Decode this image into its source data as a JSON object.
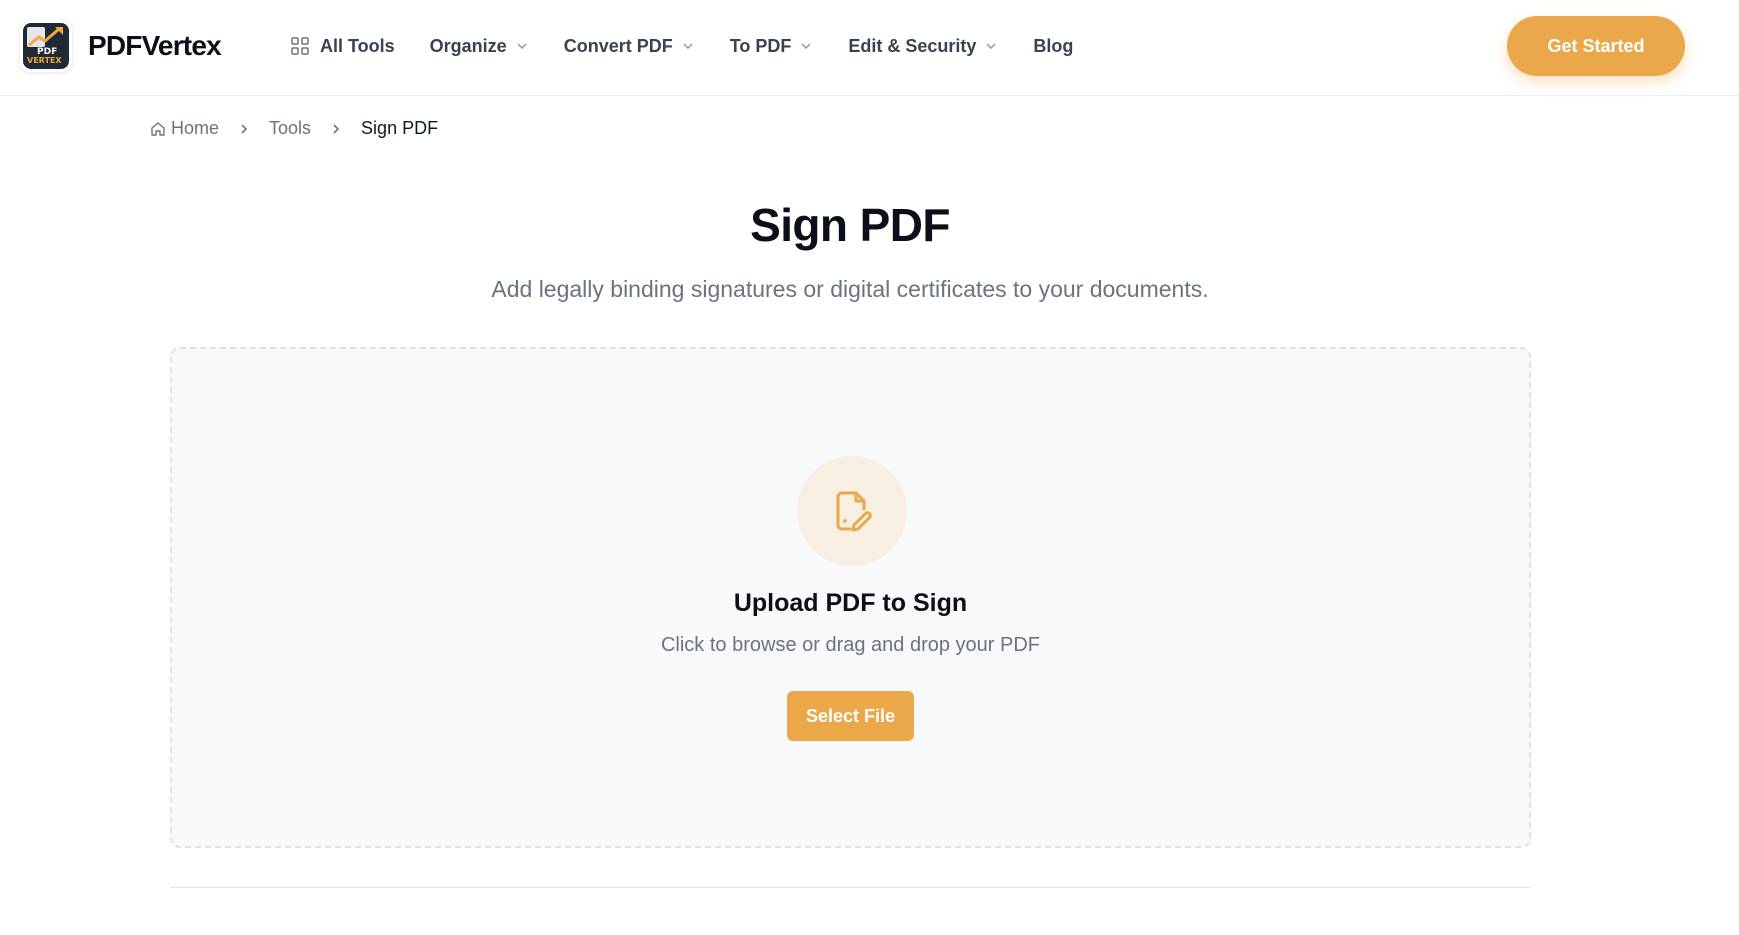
{
  "brand": {
    "name": "PDFVertex",
    "logo_text_top": "PDF",
    "logo_text_bottom": "VERTEX"
  },
  "nav": {
    "all_tools": "All Tools",
    "organize": "Organize",
    "convert_pdf": "Convert PDF",
    "to_pdf": "To PDF",
    "edit_security": "Edit & Security",
    "blog": "Blog"
  },
  "cta": {
    "label": "Get Started"
  },
  "breadcrumb": {
    "home": "Home",
    "tools": "Tools",
    "current": "Sign PDF"
  },
  "page": {
    "title": "Sign PDF",
    "subtitle": "Add legally binding signatures or digital certificates to your documents."
  },
  "dropzone": {
    "title": "Upload PDF to Sign",
    "subtitle": "Click to browse or drag and drop your PDF",
    "button": "Select File",
    "icon": "file-signature-icon"
  },
  "colors": {
    "accent": "#eba84a",
    "icon_circle_bg": "#f6efe2",
    "dropzone_bg": "#f8f9fb"
  }
}
